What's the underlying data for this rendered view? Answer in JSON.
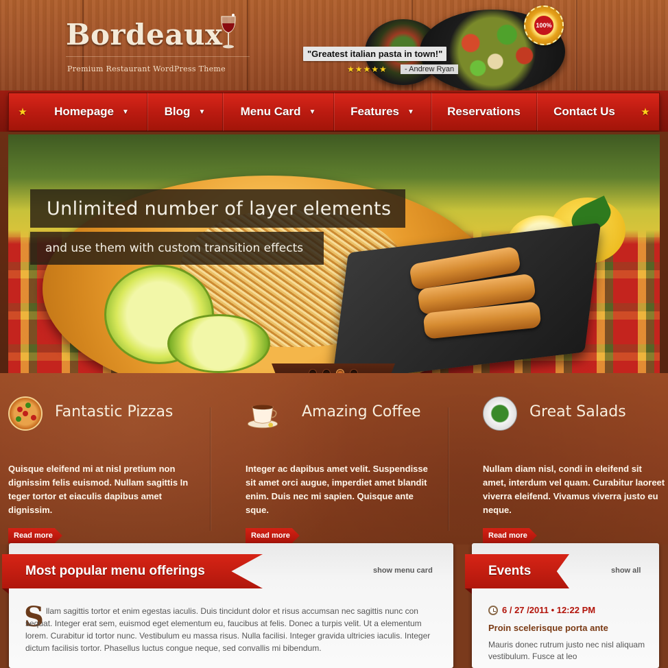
{
  "header": {
    "logo": "Bordeaux",
    "tagline": "Premium Restaurant WordPress Theme",
    "quote": "\"Greatest italian pasta in town!\"",
    "rating_stars": "★★★★★",
    "rating_value": 5,
    "quote_author": "- Andrew Ryan",
    "seal_text": "100%"
  },
  "nav": {
    "items": [
      {
        "label": "Homepage",
        "has_dropdown": true
      },
      {
        "label": "Blog",
        "has_dropdown": true
      },
      {
        "label": "Menu Card",
        "has_dropdown": true
      },
      {
        "label": "Features",
        "has_dropdown": true
      },
      {
        "label": "Reservations",
        "has_dropdown": false
      },
      {
        "label": "Contact Us",
        "has_dropdown": false
      }
    ]
  },
  "slider": {
    "caption_title": "Unlimited number of layer elements",
    "caption_sub": "and use them with custom transition effects",
    "slide_count": 4,
    "active_slide": 3
  },
  "features": [
    {
      "title": "Fantastic Pizzas",
      "icon": "pizza-icon",
      "text": "Quisque eleifend mi at nisl pretium non dignissim felis euismod. Nullam sagittis In teger tortor et eiaculis dapibus amet dignissim.",
      "button": "Read more"
    },
    {
      "title": "Amazing Coffee",
      "icon": "coffee-icon",
      "text": "Integer ac dapibus amet velit. Suspendisse sit amet orci augue, imperdiet amet blandit enim. Duis nec mi sapien. Quisque ante sque.",
      "button": "Read more"
    },
    {
      "title": "Great Salads",
      "icon": "salad-icon",
      "text": "Nullam diam nisl, condi in eleifend sit amet, interdum vel quam. Curabitur laoreet viverra eleifend. Vivamus viverra justo eu neque.",
      "button": "Read more"
    }
  ],
  "menu_panel": {
    "title": "Most popular menu offerings",
    "link": "show menu card",
    "dropcap": "S",
    "text": "llam sagittis tortor et enim egestas iaculis. Duis tincidunt dolor et risus accumsan nec sagittis nunc con sequat. Integer erat sem, euismod eget elementum eu, faucibus at felis. Donec a turpis velit. Ut a elementum lorem. Curabitur id tortor nunc. Vestibulum eu massa risus. Nulla facilisi. Integer gravida ultricies iaculis. Integer dictum facilisis tortor. Phasellus luctus congue neque, sed convallis mi bibendum."
  },
  "events_panel": {
    "title": "Events",
    "link": "show all",
    "event_date": "6 / 27 /2011 • 12:22 PM",
    "event_title": "Proin scelerisque porta ante",
    "event_text": "Mauris donec rutrum justo nec nisl aliquam vestibulum. Fusce at leo"
  },
  "colors": {
    "accent_red": "#c81e12",
    "wood": "#a2542a",
    "leather": "#8c4020",
    "star_gold": "#ffd21c"
  }
}
